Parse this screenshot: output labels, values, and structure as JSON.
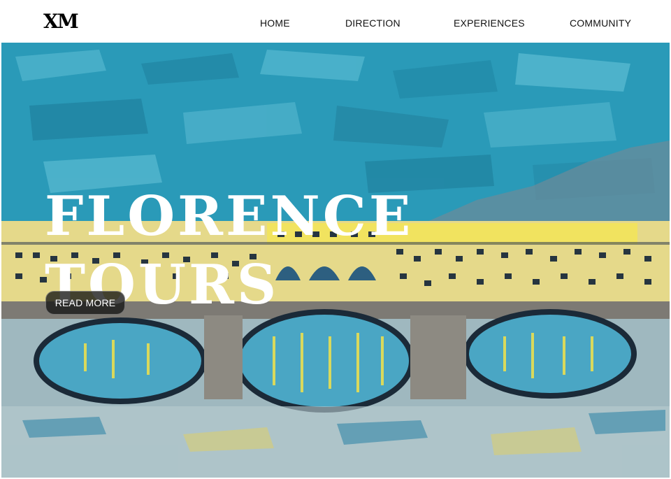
{
  "brand": {
    "logo_text": "XM"
  },
  "nav": {
    "home": "HOME",
    "direction": "DIRECTION",
    "experiences": "EXPERIENCES",
    "community": "COMMUNITY"
  },
  "hero": {
    "title_line1": "FLORENCE",
    "title_line2": "TOURS",
    "button_label": "READ MORE"
  },
  "colors": {
    "sky": "#2a9ab8",
    "buildings": "#e5d98a",
    "water": "#4aa6c4",
    "bridge": "#7d7a74"
  }
}
